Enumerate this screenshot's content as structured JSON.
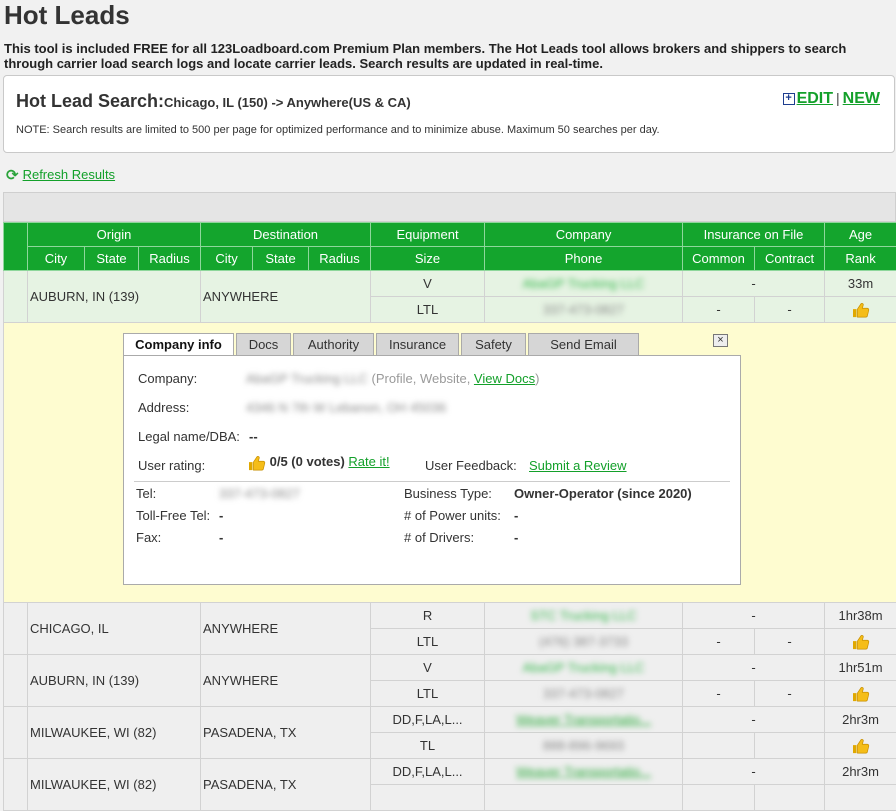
{
  "page": {
    "title": "Hot Leads",
    "intro": "This tool is included FREE for all 123Loadboard.com Premium Plan members. The Hot Leads tool allows brokers and shippers to search through carrier load search logs and locate carrier leads. Search results are updated in real-time."
  },
  "search": {
    "label": "Hot Lead Search:",
    "query": "Chicago, IL (150) -> Anywhere(US & CA)",
    "note": "NOTE: Search results are limited to 500 per page for optimized performance and to minimize abuse. Maximum 50 searches per day.",
    "edit_label": "EDIT",
    "separator": "|",
    "new_label": "NEW"
  },
  "refresh_label": "Refresh Results",
  "table": {
    "groups": [
      "Origin",
      "Destination",
      "Equipment",
      "Company",
      "Insurance on File",
      "Age"
    ],
    "subheaders": [
      "City",
      "State",
      "Radius",
      "City",
      "State",
      "Radius",
      "Size",
      "Phone",
      "Common",
      "Contract",
      "Rank"
    ],
    "rows": [
      {
        "origin": "AUBURN, IN (139)",
        "destination": "ANYWHERE",
        "equipment": "V",
        "size": "LTL",
        "company": "AbaGP Trucking LLC",
        "phone": "337-473-0827",
        "insurance": "-",
        "common": "-",
        "contract": "-",
        "age": "33m"
      },
      {
        "origin": "CHICAGO, IL",
        "destination": "ANYWHERE",
        "equipment": "R",
        "size": "LTL",
        "company": "STC Trucking LLC",
        "phone": "(476) 387-3733",
        "insurance": "-",
        "common": "-",
        "contract": "-",
        "age": "1hr38m"
      },
      {
        "origin": "AUBURN, IN (139)",
        "destination": "ANYWHERE",
        "equipment": "V",
        "size": "LTL",
        "company": "AbaGP Trucking LLC",
        "phone": "337-473-0827",
        "insurance": "-",
        "common": "-",
        "contract": "-",
        "age": "1hr51m"
      },
      {
        "origin": "MILWAUKEE, WI (82)",
        "destination": "PASADENA, TX",
        "equipment": "DD,F,LA,L...",
        "size": "TL",
        "company": "Weaver Transportatio...",
        "phone": "888-896-9693",
        "insurance": "-",
        "common": "",
        "contract": "",
        "age": "2hr3m"
      },
      {
        "origin": "MILWAUKEE, WI (82)",
        "destination": "PASADENA, TX",
        "equipment": "DD,F,LA,L...",
        "size": "",
        "company": "Weaver Transportatio...",
        "phone": "",
        "insurance": "-",
        "common": "",
        "contract": "",
        "age": "2hr3m"
      }
    ]
  },
  "popup": {
    "tabs": [
      "Company info",
      "Docs",
      "Authority",
      "Insurance",
      "Safety",
      "Send Email"
    ],
    "close": "×",
    "company_label": "Company:",
    "company_value": "AbaGP Trucking LLC",
    "profile_link": "Profile",
    "website_link": "Website",
    "view_docs": "View Docs",
    "address_label": "Address:",
    "address_value": "4346 N 7th W Lebanon, OH 45036",
    "legal_label": "Legal name/DBA:",
    "legal_value": "--",
    "rating_label": "User rating:",
    "rating_value": "0/5 (0 votes)",
    "rate_link": "Rate it!",
    "feedback_label": "User Feedback:",
    "review_link": "Submit a Review",
    "tel_label": "Tel:",
    "tel_value": "337-473-0827",
    "tollfree_label": "Toll-Free Tel:",
    "tollfree_value": "-",
    "fax_label": "Fax:",
    "fax_value": "-",
    "btype_label": "Business Type:",
    "btype_value": "Owner-Operator (since 2020)",
    "power_label": "# of Power units:",
    "power_value": "-",
    "drivers_label": "# of Drivers:",
    "drivers_value": "-"
  },
  "colors": {
    "header_green": "#14a52d",
    "link_green": "#13a02a",
    "detail_yellow": "#fefcd0",
    "thumb": "#f0b400"
  },
  "icons": {
    "thumb": "thumbs-up-icon",
    "refresh": "refresh-icon",
    "plus": "plus-icon",
    "close": "close-icon"
  }
}
